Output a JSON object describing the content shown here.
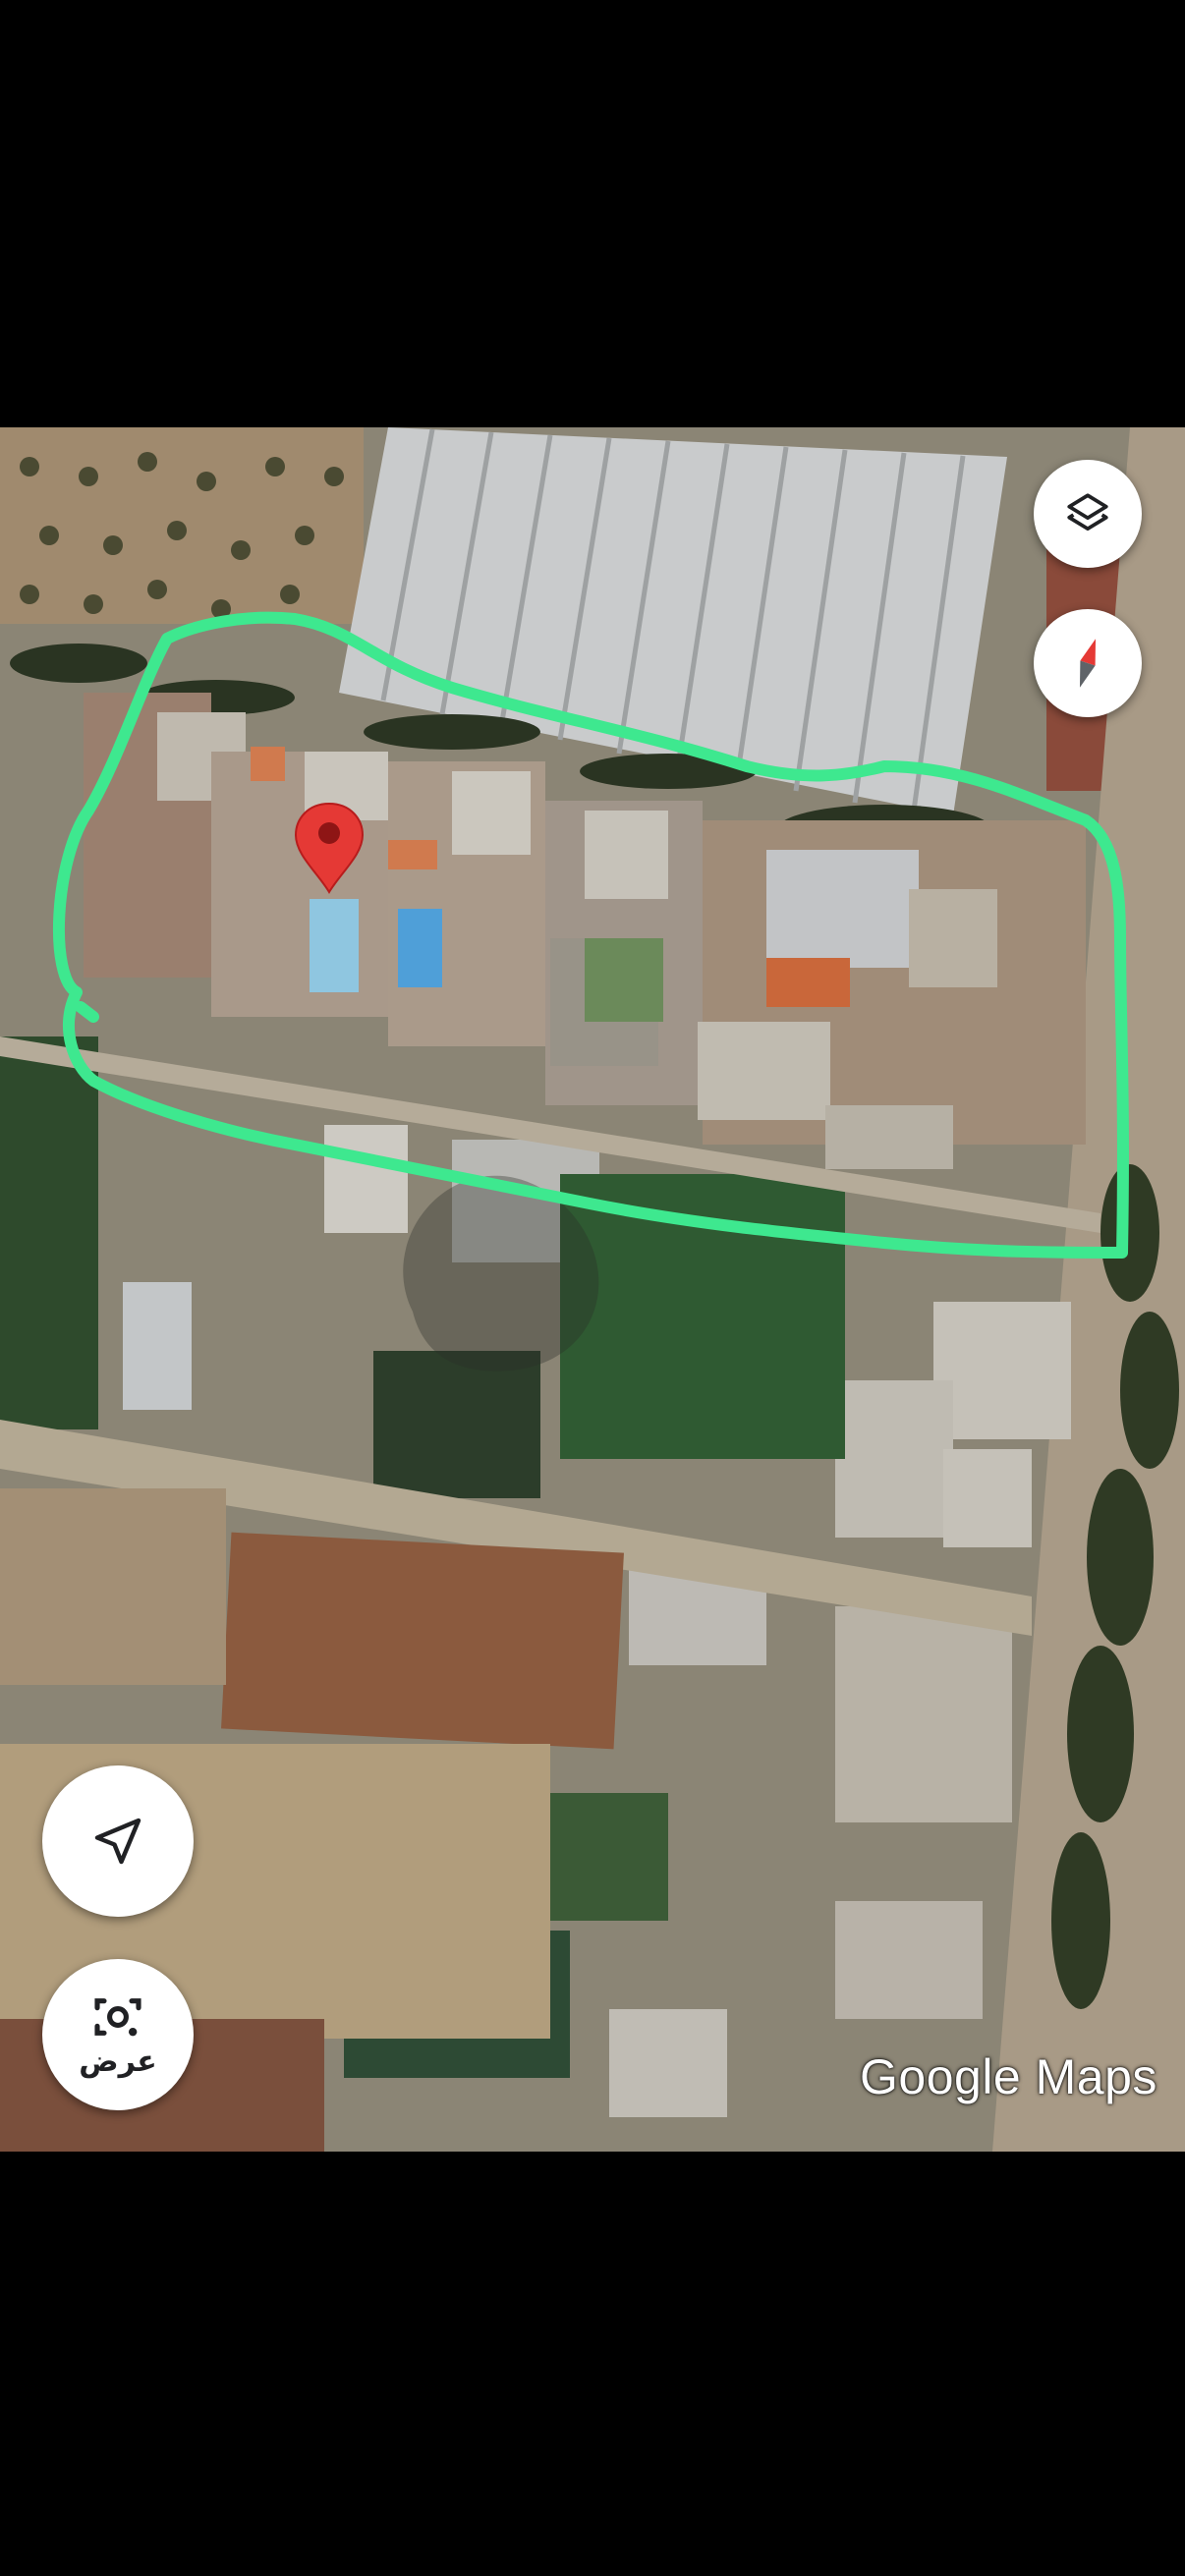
{
  "map": {
    "type": "satellite",
    "attribution": "Google Maps",
    "marker": {
      "icon": "map-pin-icon",
      "color": "#e53935"
    },
    "boundary_outline": {
      "color": "#3ee88f"
    }
  },
  "controls": {
    "layers": {
      "icon": "layers-icon"
    },
    "compass": {
      "icon": "compass-icon",
      "colors": [
        "#e53935",
        "#5f6368"
      ]
    },
    "locate": {
      "icon": "navigation-arrow-icon"
    },
    "lens": {
      "icon": "camera-search-icon",
      "label": "عرض"
    }
  },
  "colors": {
    "outline": "#3ee88f",
    "marker": "#e53935",
    "control_bg": "#ffffff",
    "control_icon": "#202124"
  }
}
